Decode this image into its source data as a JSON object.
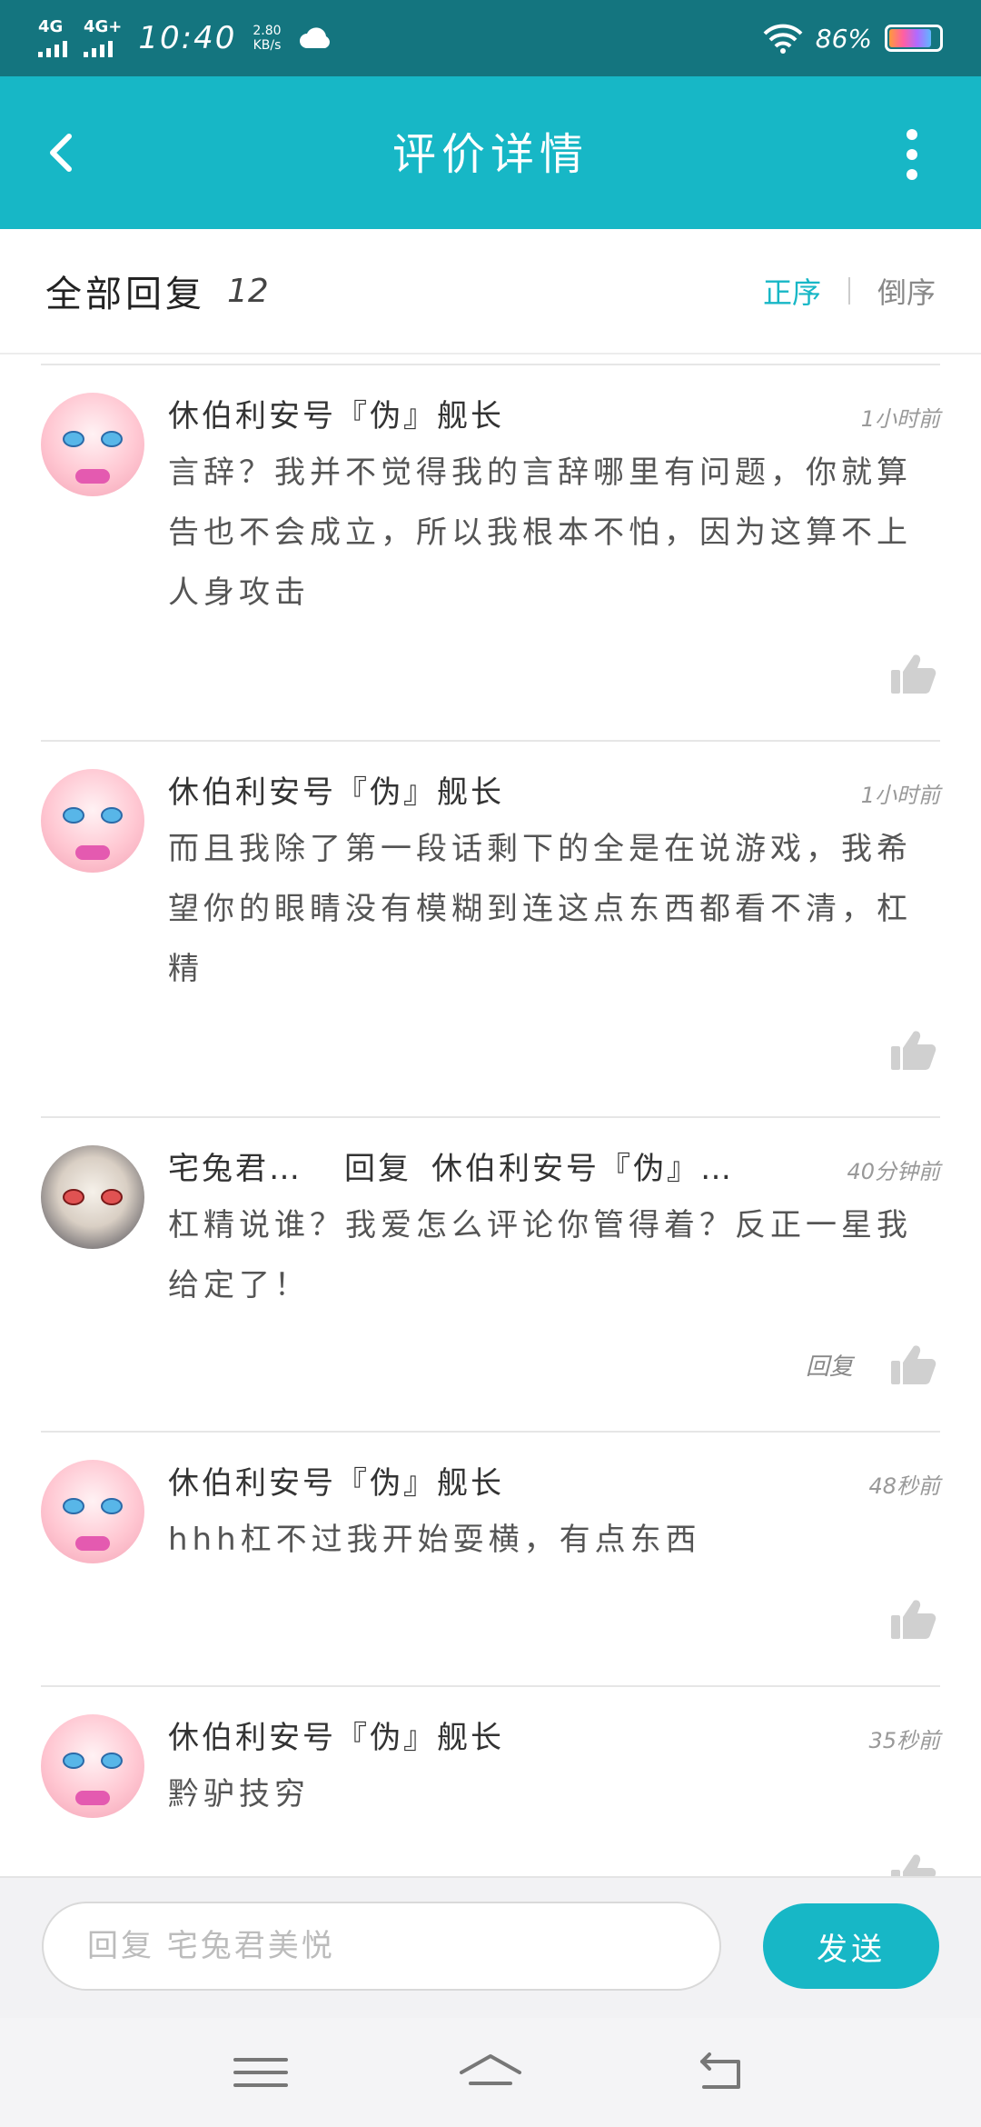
{
  "status_bar": {
    "network_1": "4G",
    "network_2": "4G+",
    "time": "10:40",
    "speed_value": "2.80",
    "speed_unit": "KB/s",
    "battery": "86%",
    "battery_level": 0.86,
    "icons": [
      "signal-icon",
      "cloud-icon",
      "wifi-icon",
      "battery-icon"
    ]
  },
  "header": {
    "title": "评价详情",
    "back_icon": "chevron-left-icon",
    "more_icon": "more-vertical-icon"
  },
  "reply_summary": {
    "label": "全部回复",
    "count": "12",
    "sort_asc": "正序",
    "sort_desc": "倒序"
  },
  "comments": [
    {
      "author": "休伯利安号『伪』舰长",
      "time": "1小时前",
      "text": "言辞？我并不觉得我的言辞哪里有问题，你就算告也不会成立，所以我根本不怕，因为这算不上人身攻击"
    },
    {
      "author": "休伯利安号『伪』舰长",
      "time": "1小时前",
      "text": "而且我除了第一段话剩下的全是在说游戏，我希望你的眼睛没有模糊到连这点东西都看不清，杠精"
    },
    {
      "author": "宅兔君…",
      "reply_word": "回复",
      "reply_target": "休伯利安号『伪』…",
      "time": "40分钟前",
      "text": "杠精说谁？我爱怎么评论你管得着？反正一星我给定了！",
      "reply_link": "回复"
    },
    {
      "author": "休伯利安号『伪』舰长",
      "time": "48秒前",
      "text": "hhh杠不过我开始耍横，有点东西"
    },
    {
      "author": "休伯利安号『伪』舰长",
      "time": "35秒前",
      "text": "黔驴技穷"
    }
  ],
  "input_bar": {
    "placeholder": "回复 宅兔君美悦",
    "send_label": "发送"
  },
  "nav": {
    "icons": [
      "menu-icon",
      "home-icon",
      "back-icon"
    ]
  },
  "colors": {
    "accent": "#17b7c6",
    "status_bar": "#14757f"
  }
}
